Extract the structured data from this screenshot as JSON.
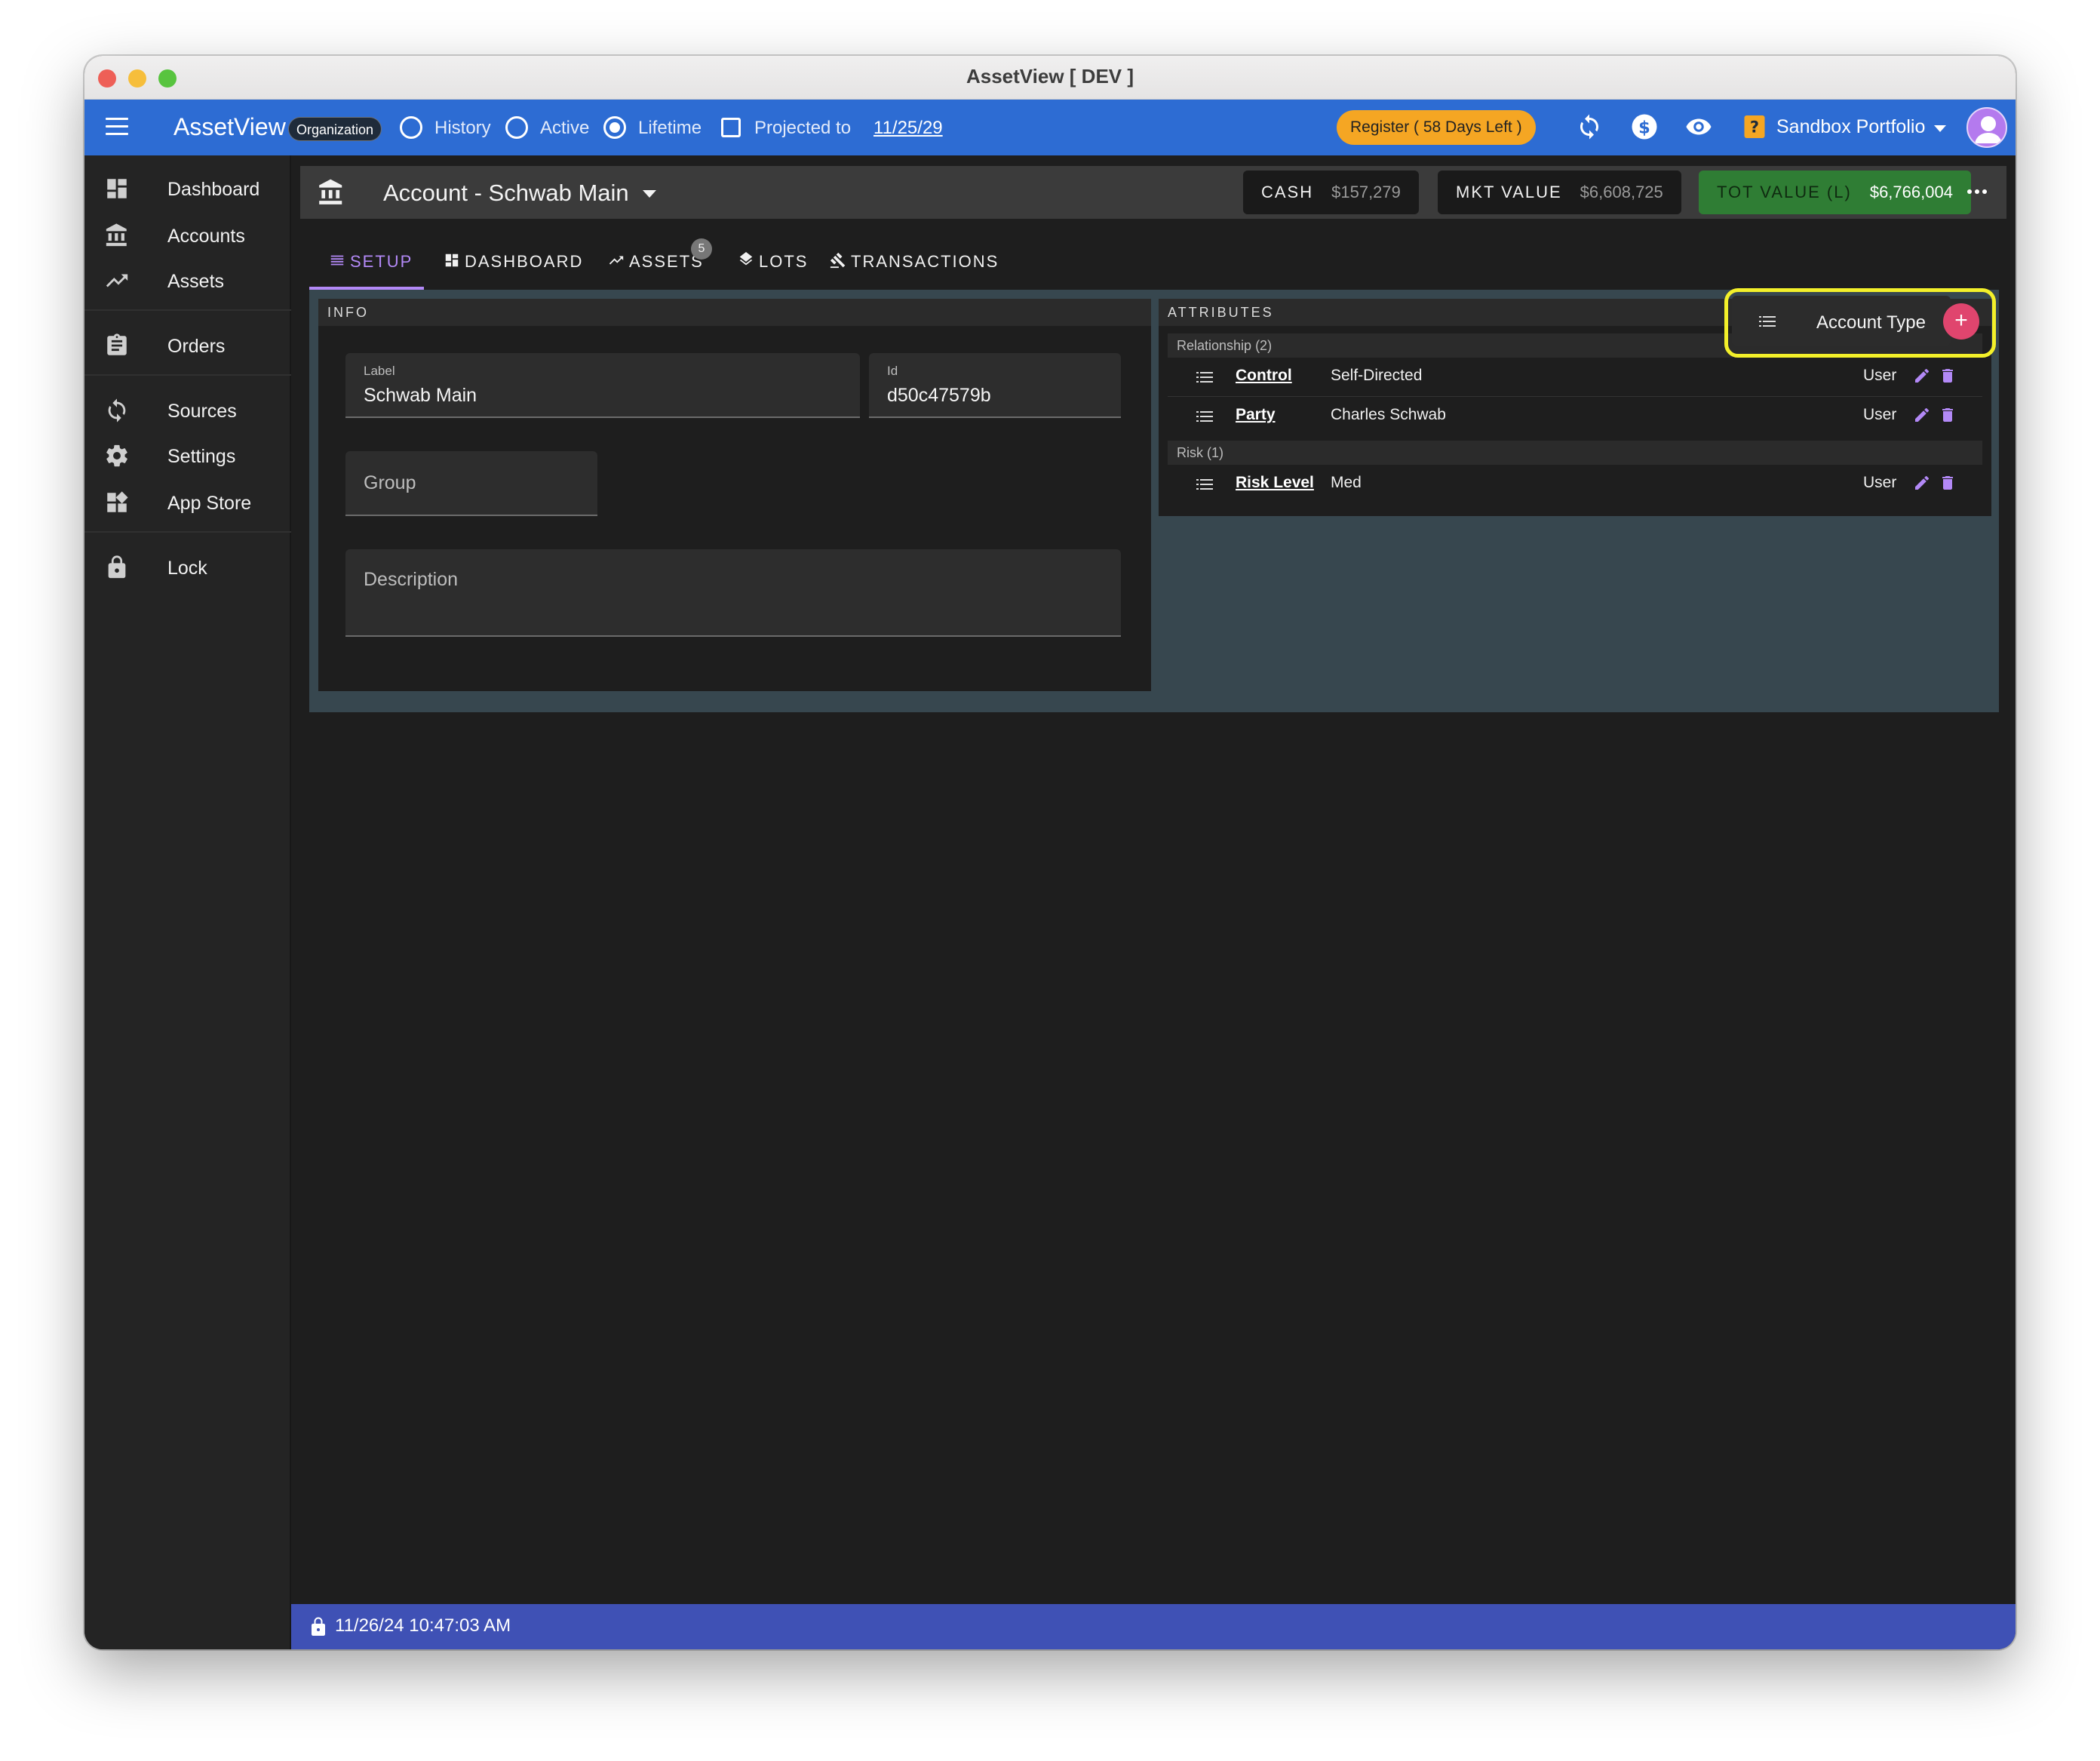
{
  "window": {
    "title": "AssetView [ DEV ]"
  },
  "appbar": {
    "brand": "AssetView",
    "org_badge": "Organization",
    "view_options": [
      {
        "label": "History",
        "selected": false
      },
      {
        "label": "Active",
        "selected": false
      },
      {
        "label": "Lifetime",
        "selected": true
      }
    ],
    "projected_label": "Projected to",
    "projected_date": "11/25/29",
    "projected_checked": false,
    "register_label": "Register ( 58 Days Left )",
    "icons": [
      "sync-icon",
      "dollar-icon",
      "eye-icon",
      "help-icon"
    ],
    "portfolio": "Sandbox Portfolio",
    "accent": "#2d6cd3"
  },
  "sidebar": {
    "items": [
      {
        "label": "Dashboard",
        "icon": "dashboard-icon"
      },
      {
        "label": "Accounts",
        "icon": "bank-icon"
      },
      {
        "label": "Assets",
        "icon": "trending-up-icon"
      },
      {
        "label": "Orders",
        "icon": "clipboard-icon"
      },
      {
        "label": "Sources",
        "icon": "sync-icon"
      },
      {
        "label": "Settings",
        "icon": "gear-icon"
      },
      {
        "label": "App Store",
        "icon": "apps-icon"
      },
      {
        "label": "Lock",
        "icon": "lock-icon"
      }
    ]
  },
  "account": {
    "title": "Account - Schwab Main",
    "cash_label": "CASH",
    "cash_value": "$157,279",
    "mkt_label": "MKT VALUE",
    "mkt_value": "$6,608,725",
    "tot_label": "TOT VALUE (L)",
    "tot_value": "$6,766,004"
  },
  "tabs": [
    {
      "label": "SETUP",
      "active": true
    },
    {
      "label": "DASHBOARD",
      "active": false
    },
    {
      "label": "ASSETS",
      "active": false,
      "badge": "5"
    },
    {
      "label": "LOTS",
      "active": false
    },
    {
      "label": "TRANSACTIONS",
      "active": false
    }
  ],
  "info": {
    "title": "INFO",
    "label_field": {
      "label": "Label",
      "value": "Schwab Main"
    },
    "id_field": {
      "label": "Id",
      "value": "d50c47579b"
    },
    "group_placeholder": "Group",
    "description_placeholder": "Description"
  },
  "attributes": {
    "title": "ATTRIBUTES",
    "groups": [
      {
        "name": "Relationship (2)",
        "rows": [
          {
            "name": "Control",
            "value": "Self-Directed",
            "source": "User"
          },
          {
            "name": "Party",
            "value": "Charles Schwab",
            "source": "User"
          }
        ]
      },
      {
        "name": "Risk (1)",
        "rows": [
          {
            "name": "Risk Level",
            "value": "Med",
            "source": "User"
          }
        ]
      }
    ],
    "new_attribute_label": "Account Type",
    "add_button": "+"
  },
  "status": {
    "timestamp": "11/26/24 10:47:03 AM"
  }
}
